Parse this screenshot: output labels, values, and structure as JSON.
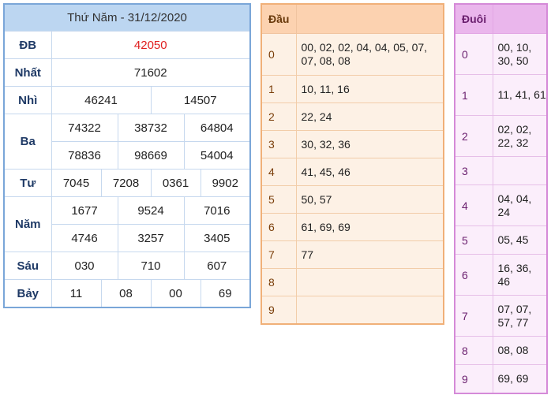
{
  "results": {
    "title": "Thứ Năm - 31/12/2020",
    "db": {
      "label": "ĐB",
      "values": [
        "42050"
      ]
    },
    "nhat": {
      "label": "Nhất",
      "values": [
        "71602"
      ]
    },
    "nhi": {
      "label": "Nhì",
      "values": [
        "46241",
        "14507"
      ]
    },
    "ba": {
      "label": "Ba",
      "row1": [
        "74322",
        "38732",
        "64804"
      ],
      "row2": [
        "78836",
        "98669",
        "54004"
      ]
    },
    "tu": {
      "label": "Tư",
      "values": [
        "7045",
        "7208",
        "0361",
        "9902"
      ]
    },
    "nam": {
      "label": "Năm",
      "row1": [
        "1677",
        "9524",
        "7016"
      ],
      "row2": [
        "4746",
        "3257",
        "3405"
      ]
    },
    "sau": {
      "label": "Sáu",
      "values": [
        "030",
        "710",
        "607"
      ]
    },
    "bay": {
      "label": "Bảy",
      "values": [
        "11",
        "08",
        "00",
        "69"
      ]
    },
    "highlight_color": "#e02020"
  },
  "dau": {
    "header": "Đầu",
    "rows": [
      {
        "key": "0",
        "value": "00, 02, 02, 04, 04, 05, 07, 07, 08, 08"
      },
      {
        "key": "1",
        "value": "10, 11, 16"
      },
      {
        "key": "2",
        "value": "22, 24"
      },
      {
        "key": "3",
        "value": "30, 32, 36"
      },
      {
        "key": "4",
        "value": "41, 45, 46"
      },
      {
        "key": "5",
        "value": "50, 57"
      },
      {
        "key": "6",
        "value": "61, 69, 69"
      },
      {
        "key": "7",
        "value": "77"
      },
      {
        "key": "8",
        "value": ""
      },
      {
        "key": "9",
        "value": ""
      }
    ]
  },
  "duoi": {
    "header": "Đuôi",
    "rows": [
      {
        "key": "0",
        "value": "00, 10, 30, 50"
      },
      {
        "key": "1",
        "value": "11, 41, 61"
      },
      {
        "key": "2",
        "value": "02, 02, 22, 32"
      },
      {
        "key": "3",
        "value": ""
      },
      {
        "key": "4",
        "value": "04, 04, 24"
      },
      {
        "key": "5",
        "value": "05, 45"
      },
      {
        "key": "6",
        "value": "16, 36, 46"
      },
      {
        "key": "7",
        "value": "07, 07, 57, 77"
      },
      {
        "key": "8",
        "value": "08, 08"
      },
      {
        "key": "9",
        "value": "69, 69"
      }
    ]
  }
}
